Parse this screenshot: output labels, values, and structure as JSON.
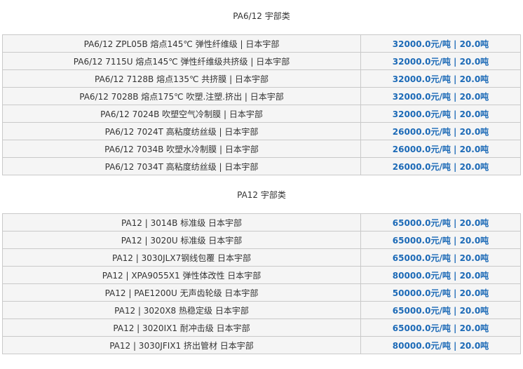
{
  "sections": [
    {
      "title": "PA6/12 宇部类",
      "rows": [
        {
          "name": "PA6/12 ZPL05B 熔点145℃ 弹性纤维级 | 日本宇部",
          "price": "32000.0元/吨 | 20.0吨"
        },
        {
          "name": "PA6/12 7115U 熔点145℃ 弹性纤维级共挤级 | 日本宇部",
          "price": "32000.0元/吨 | 20.0吨"
        },
        {
          "name": "PA6/12 7128B 熔点135℃ 共挤膜 | 日本宇部",
          "price": "32000.0元/吨 | 20.0吨"
        },
        {
          "name": "PA6/12 7028B 熔点175℃ 吹塑.注塑.挤出 | 日本宇部",
          "price": "32000.0元/吨 | 20.0吨"
        },
        {
          "name": "PA6/12 7024B 吹塑空气冷制膜 | 日本宇部",
          "price": "32000.0元/吨 | 20.0吨"
        },
        {
          "name": "PA6/12 7024T 高粘度纺丝级 | 日本宇部",
          "price": "26000.0元/吨 | 20.0吨"
        },
        {
          "name": "PA6/12 7034B 吹塑水冷制膜 | 日本宇部",
          "price": "26000.0元/吨 | 20.0吨"
        },
        {
          "name": "PA6/12 7034T 高粘度纺丝级 | 日本宇部",
          "price": "26000.0元/吨 | 20.0吨"
        }
      ]
    },
    {
      "title": "PA12 宇部类",
      "rows": [
        {
          "name": "PA12 | 3014B 标准级 日本宇部",
          "price": "65000.0元/吨 | 20.0吨"
        },
        {
          "name": "PA12 | 3020U 标准级 日本宇部",
          "price": "65000.0元/吨 | 20.0吨"
        },
        {
          "name": "PA12 | 3030JLX7钢线包覆 日本宇部",
          "price": "65000.0元/吨 | 20.0吨"
        },
        {
          "name": "PA12 | XPA9055X1 弹性体改性 日本宇部",
          "price": "80000.0元/吨 | 20.0吨"
        },
        {
          "name": "PA12 | PAE1200U 无声齿轮级 日本宇部",
          "price": "50000.0元/吨 | 20.0吨"
        },
        {
          "name": "PA12 | 3020X8 热稳定级 日本宇部",
          "price": "65000.0元/吨 | 20.0吨"
        },
        {
          "name": "PA12 | 3020IX1 耐冲击级 日本宇部",
          "price": "65000.0元/吨 | 20.0吨"
        },
        {
          "name": "PA12 | 3030JFIX1 挤出管材 日本宇部",
          "price": "80000.0元/吨 | 20.0吨"
        }
      ]
    }
  ]
}
